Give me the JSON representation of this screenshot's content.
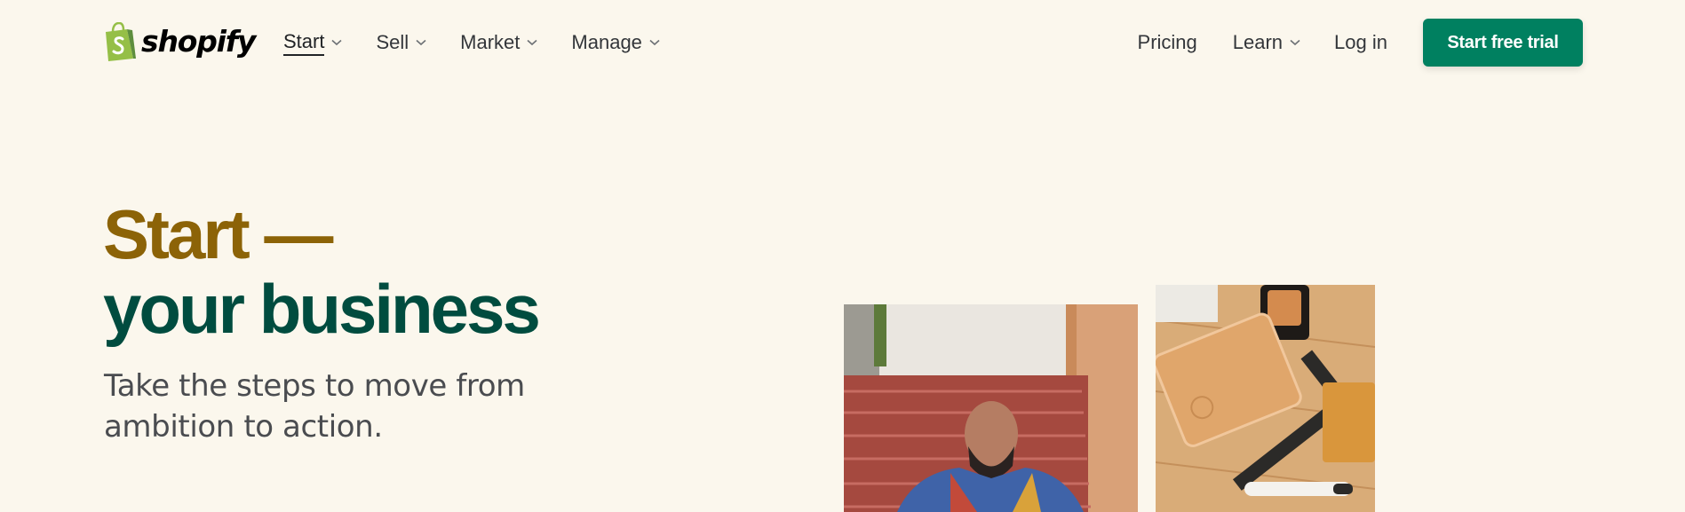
{
  "header": {
    "logo_text": "shopify",
    "nav_left": [
      {
        "label": "Start",
        "active": true
      },
      {
        "label": "Sell"
      },
      {
        "label": "Market"
      },
      {
        "label": "Manage"
      }
    ],
    "nav_right": {
      "pricing": "Pricing",
      "learn": "Learn",
      "login": "Log in",
      "cta": "Start free trial"
    }
  },
  "hero": {
    "title_line1": "Start —",
    "title_line2": "your business",
    "subtitle": "Take the steps to move from ambition to action."
  },
  "colors": {
    "background": "#fbf7ed",
    "brand_green": "#008060",
    "title_gold": "#8c6307",
    "title_green": "#004c3f"
  },
  "icons": [
    "shopify-bag-icon",
    "chevron-down-icon"
  ]
}
